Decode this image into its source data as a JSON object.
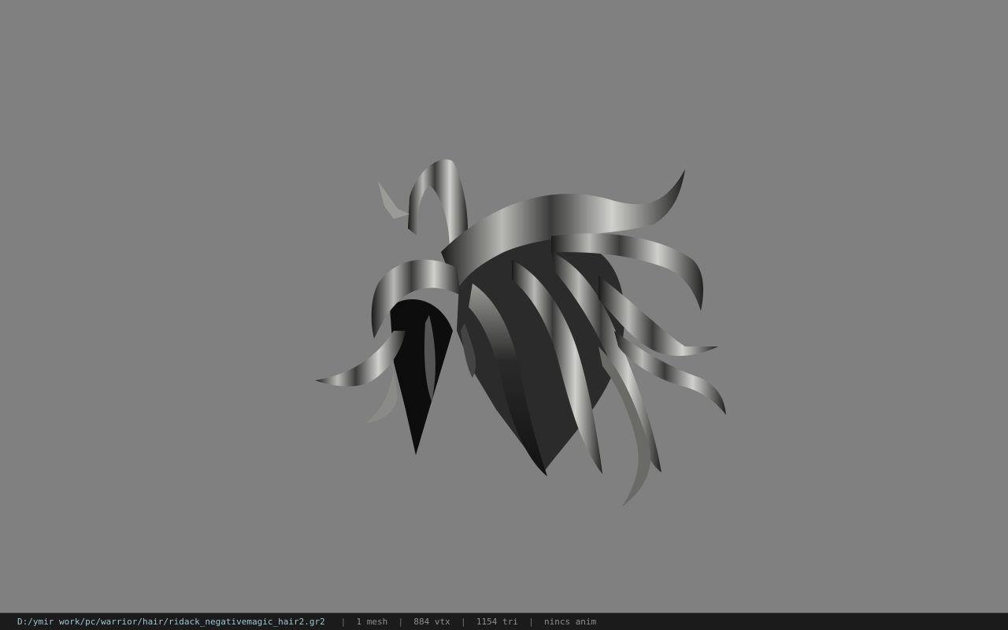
{
  "viewport": {
    "background_color": "#808080",
    "model_name": "hair-mesh"
  },
  "status_bar": {
    "file_path": "D:/ymir work/pc/warrior/hair/ridack_negativemagic_hair2.gr2",
    "separator": "|",
    "mesh_count": "1 mesh",
    "vertex_count": "884 vtx",
    "triangle_count": "1154 tri",
    "animation": "nincs anim",
    "path_color": "#9ec5cf",
    "text_color": "#8e8e8e"
  }
}
